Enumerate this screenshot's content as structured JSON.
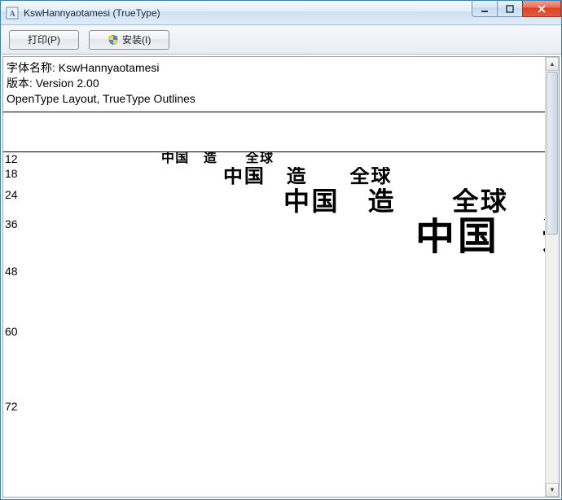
{
  "window": {
    "title": "KswHannyaotamesi (TrueType)"
  },
  "toolbar": {
    "print_label": "打印(P)",
    "install_label": "安装(I)"
  },
  "meta": {
    "name_label": "字体名称: KswHannyaotamesi",
    "version_label": "版本: Version 2.00",
    "layout_label": "OpenType Layout, TrueType Outlines"
  },
  "sample_text": "中国　造　　全球",
  "sizes": {
    "s12": "12",
    "s18": "18",
    "s24": "24",
    "s36": "36",
    "s48": "48",
    "s60": "60",
    "s72": "72"
  }
}
